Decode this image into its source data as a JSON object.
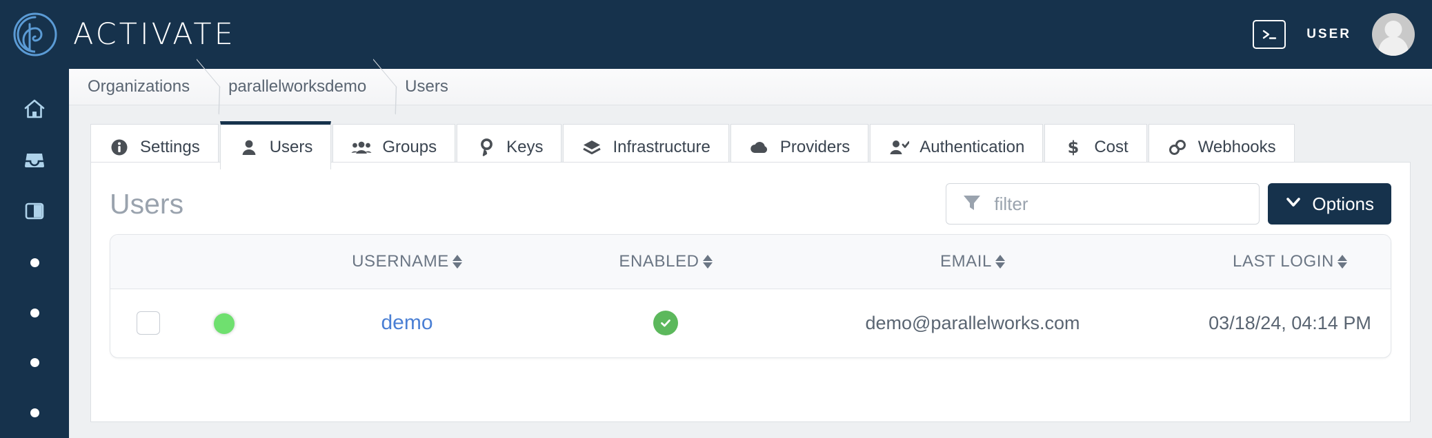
{
  "header": {
    "brand_name": "ACTIVATE",
    "brand_logo_icon": "spiral-fingerprint-logo",
    "terminal_icon": "terminal-icon",
    "user_label": "USER",
    "avatar_icon": "avatar-icon",
    "background_color": "#16324c"
  },
  "sidebar": {
    "background_color": "#16324c",
    "items": [
      {
        "icon": "home-icon"
      },
      {
        "icon": "inbox-icon"
      },
      {
        "icon": "panel-layout-icon"
      },
      {
        "icon": "dot-icon"
      },
      {
        "icon": "dot-icon"
      },
      {
        "icon": "dot-icon"
      },
      {
        "icon": "dot-icon"
      }
    ]
  },
  "breadcrumb": {
    "items": [
      {
        "label": "Organizations"
      },
      {
        "label": "parallelworksdemo"
      },
      {
        "label": "Users"
      }
    ]
  },
  "tabs": [
    {
      "label": "Settings",
      "icon": "info-circle-icon",
      "active": false
    },
    {
      "label": "Users",
      "icon": "user-icon",
      "active": true
    },
    {
      "label": "Groups",
      "icon": "users-group-icon",
      "active": false
    },
    {
      "label": "Keys",
      "icon": "key-icon",
      "active": false
    },
    {
      "label": "Infrastructure",
      "icon": "layers-icon",
      "active": false
    },
    {
      "label": "Providers",
      "icon": "cloud-icon",
      "active": false
    },
    {
      "label": "Authentication",
      "icon": "user-check-icon",
      "active": false
    },
    {
      "label": "Cost",
      "icon": "dollar-sign-icon",
      "active": false
    },
    {
      "label": "Webhooks",
      "icon": "link-chain-icon",
      "active": false
    }
  ],
  "panel": {
    "title": "Users",
    "filter": {
      "icon": "filter-funnel-icon",
      "value": "",
      "placeholder": "filter"
    },
    "options_button": {
      "label": "Options",
      "icon": "chevron-down-icon",
      "color": "#16324c"
    }
  },
  "table": {
    "columns": [
      {
        "label": "USERNAME",
        "sortable": true
      },
      {
        "label": "ENABLED",
        "sortable": true
      },
      {
        "label": "EMAIL",
        "sortable": true
      },
      {
        "label": "LAST LOGIN",
        "sortable": true
      }
    ],
    "rows": [
      {
        "checkbox_checked": false,
        "status_icon": "green-status-dot",
        "status_color": "#6fe06f",
        "username": "demo",
        "enabled_icon": "green-check-circle-icon",
        "enabled_color": "#5cb85c",
        "email": "demo@parallelworks.com",
        "last_login": "03/18/24, 04:14 PM"
      }
    ]
  }
}
